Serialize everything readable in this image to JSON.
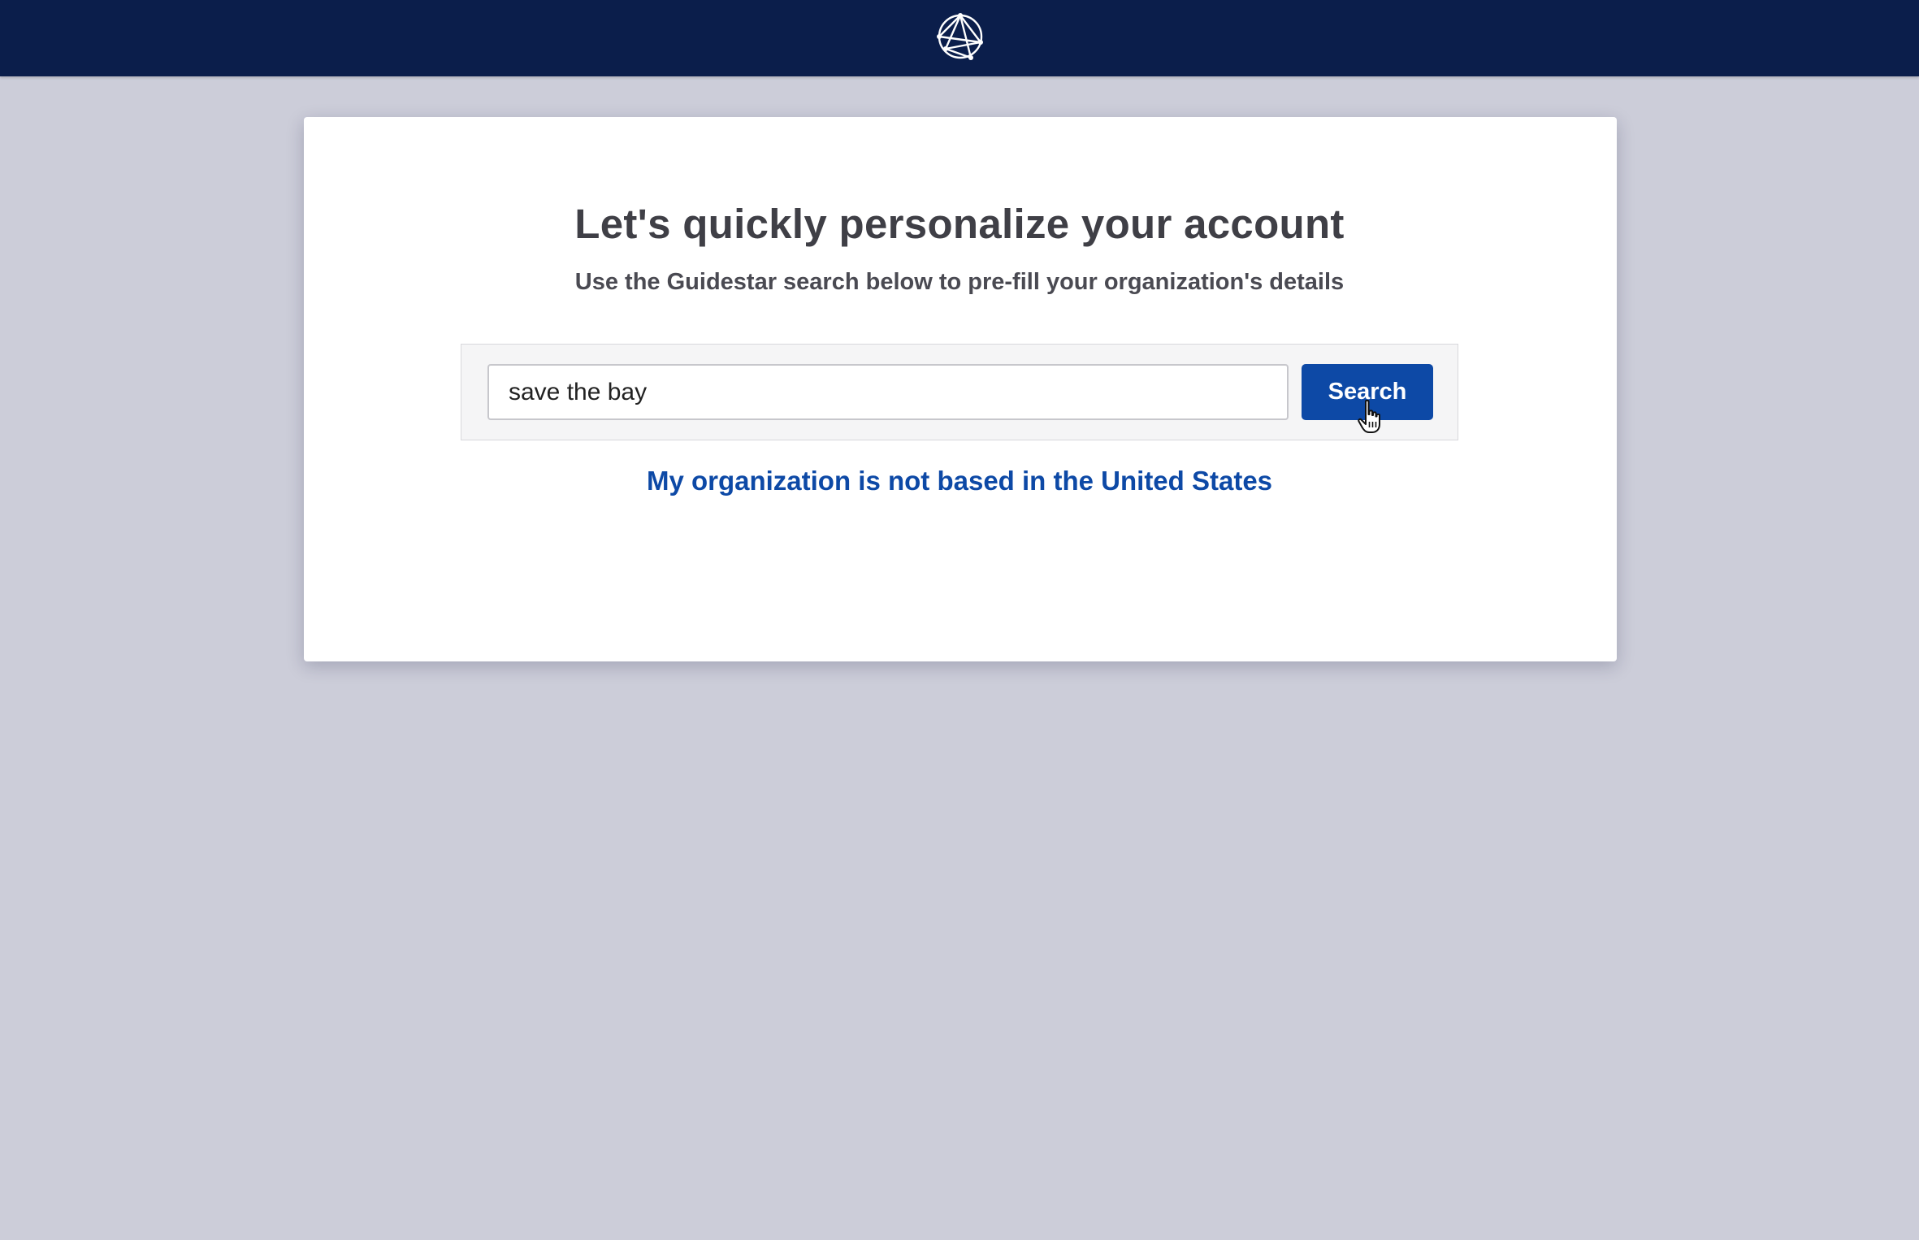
{
  "header": {
    "logo_icon": "network-globe-logo-icon",
    "background_color": "#0b1e4b"
  },
  "card": {
    "heading": "Let's quickly personalize your account",
    "subheading": "Use the Guidestar search below to pre-fill your organization's details"
  },
  "search": {
    "value": "save the bay",
    "button_label": "Search",
    "accent_color": "#0d49a6"
  },
  "links": {
    "not_us": "My organization is not based in the United States"
  },
  "cursor": {
    "icon": "hand-pointer-cursor-icon"
  }
}
